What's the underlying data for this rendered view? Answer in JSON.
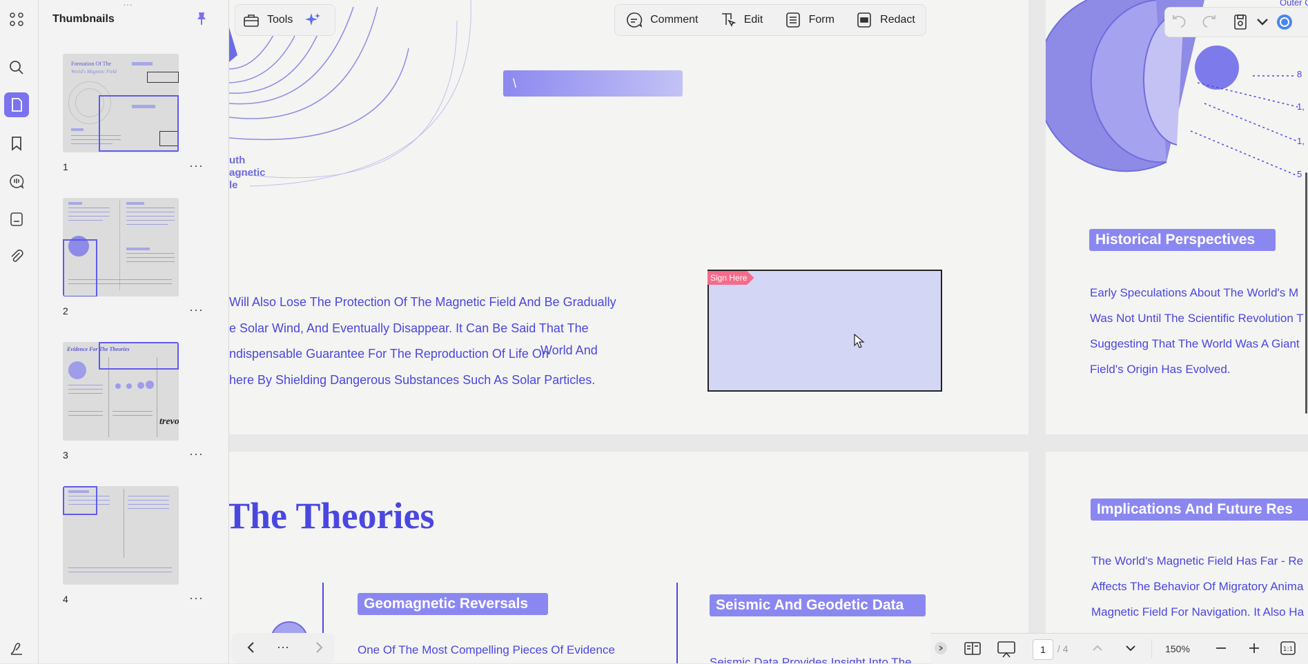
{
  "rail": {
    "items": [
      "apps-icon",
      "search-icon",
      "pages-icon",
      "bookmark-icon",
      "comments-icon",
      "forms-icon",
      "attachment-icon"
    ],
    "bottom_icon": "sign-icon"
  },
  "thumbnails": {
    "title": "Thumbnails",
    "pages": [
      {
        "num": "1",
        "title_a": "Formation Of The",
        "title_b": "World's Magnetic Field"
      },
      {
        "num": "2"
      },
      {
        "num": "3",
        "title_a": "Evidence For The Theories",
        "signature": "trevor"
      },
      {
        "num": "4"
      }
    ],
    "more": "···"
  },
  "toolbar": {
    "tools_label": "Tools",
    "comment_label": "Comment",
    "edit_label": "Edit",
    "form_label": "Form",
    "redact_label": "Redact"
  },
  "page1": {
    "field_value": "\\",
    "left_labels": [
      "uth",
      "agnetic",
      "le"
    ],
    "paragraph": [
      "Will Also Lose The Protection Of The Magnetic Field And Be Gradually",
      "e Solar Wind, And Eventually Disappear. It Can Be Said That The",
      "ndispensable Guarantee For The Reproduction Of Life On",
      "here By Shielding Dangerous Substances Such As Solar Particles."
    ],
    "inline_extra": "World And",
    "sign_tag": "Sign Here"
  },
  "page2": {
    "heading": "Historical Perspectives",
    "lines": [
      "Early Speculations About The World's M",
      "Was Not Until The Scientific Revolution T",
      "Suggesting That The World Was A Giant",
      "Field's Origin Has Evolved."
    ],
    "labels": [
      "8",
      "1,",
      "1,",
      "5"
    ],
    "top_label": "Outer C"
  },
  "page3": {
    "heading": "The Theories",
    "sub1": "Geomagnetic Reversals",
    "sub1_text": "One Of The Most Compelling Pieces Of Evidence",
    "sub2": "Seismic And Geodetic Data",
    "sub2_text": "Seismic Data Provides Insight Into The"
  },
  "page4": {
    "heading": "Implications And Future Res",
    "lines": [
      "The World's Magnetic Field Has Far - Re",
      "Affects The Behavior Of Migratory Anima",
      "Magnetic Field For Navigation. It Also Ha"
    ]
  },
  "bottom": {
    "page_current": "1",
    "page_total": "/ 4",
    "zoom": "150%",
    "nav_more": "···"
  },
  "colors": {
    "accent": "#7b72ee",
    "text_blue": "#4a47e0",
    "pill": "#8b87f1",
    "sign_tag": "#f56b8a"
  }
}
